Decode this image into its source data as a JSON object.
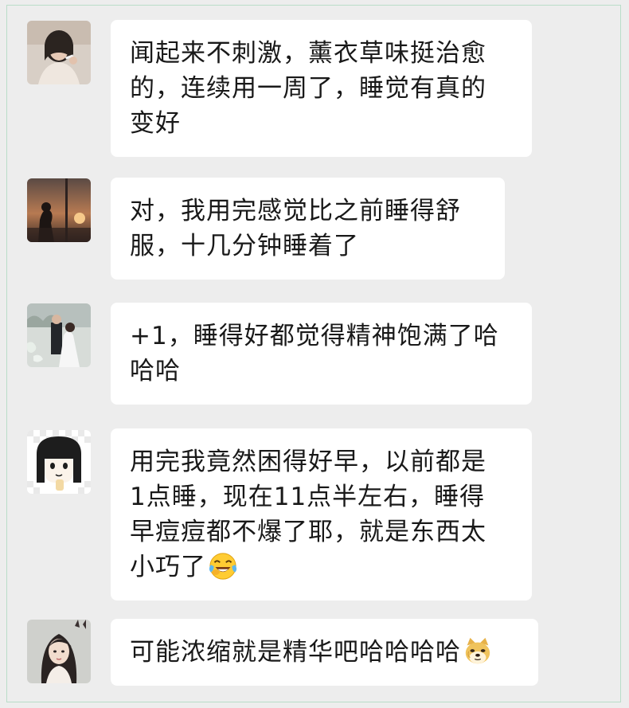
{
  "messages": [
    {
      "avatar": "avatar-woman-smoking",
      "lines": [
        "闻起来不刺激，薰衣草味挺治愈",
        "的，连续用一周了，睡觉有真的",
        "变好"
      ],
      "emoji": null
    },
    {
      "avatar": "avatar-sunset-silhouette",
      "lines": [
        "对，我用完感觉比之前睡得舒",
        "服，十几分钟睡着了"
      ],
      "emoji": null
    },
    {
      "avatar": "avatar-wedding-couple",
      "lines": [
        "+1，睡得好都觉得精神饱满了哈",
        "哈哈"
      ],
      "emoji": null
    },
    {
      "avatar": "avatar-cartoon-girl",
      "lines": [
        "用完我竟然困得好早，以前都是",
        "1点睡，现在11点半左右，睡得",
        "早痘痘都不爆了耶，就是东西太",
        "小巧了"
      ],
      "emoji": "laughing-crying-face-icon"
    },
    {
      "avatar": "avatar-illustrated-woman",
      "lines": [
        "可能浓缩就是精华吧哈哈哈哈"
      ],
      "emoji": "doge-icon"
    }
  ]
}
